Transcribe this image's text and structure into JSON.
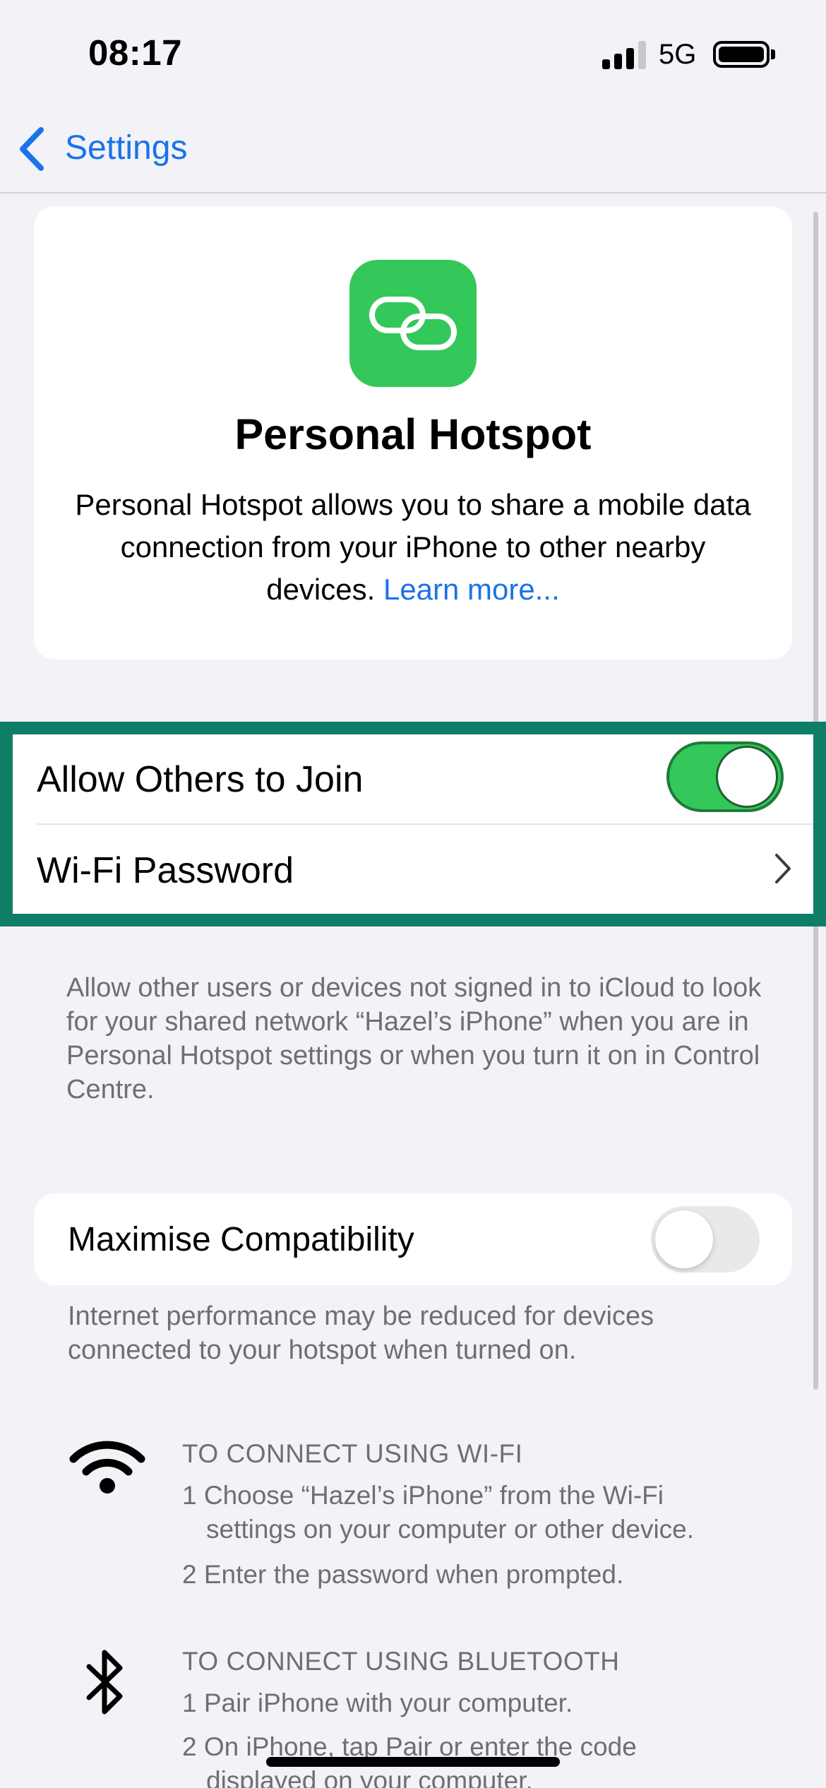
{
  "status_bar": {
    "time": "08:17",
    "network": "5G",
    "signal_bars_active": 3,
    "signal_bars_total": 4,
    "battery_level": 1.0
  },
  "nav": {
    "back_label": "Settings",
    "back_icon": "chevron-left-icon"
  },
  "header": {
    "icon": "link-icon",
    "title": "Personal Hotspot",
    "description": "Personal Hotspot allows you to share a mobile data connection from your iPhone to other nearby devices.",
    "learn_more": "Learn more..."
  },
  "settings": {
    "allow_others_label": "Allow Others to Join",
    "allow_others_on": true,
    "wifi_password_label": "Wi-Fi Password",
    "allow_others_footnote": "Allow other users or devices not signed in to iCloud to look for your shared network “Hazel’s iPhone” when you are in Personal Hotspot settings or when you turn it on in Control Centre.",
    "maximise_label": "Maximise Compatibility",
    "maximise_on": false,
    "maximise_footnote": "Internet performance may be reduced for devices connected to your hotspot when turned on."
  },
  "instructions": {
    "wifi": {
      "icon": "wifi-icon",
      "heading": "TO CONNECT USING WI-FI",
      "step1": "1 Choose “Hazel’s iPhone” from the Wi-Fi",
      "step1_cont": "settings on your computer or other device.",
      "step2": "2 Enter the password when prompted."
    },
    "bluetooth": {
      "icon": "bluetooth-icon",
      "heading": "TO CONNECT USING BLUETOOTH",
      "step1": "1 Pair iPhone with your computer.",
      "step2": "2 On iPhone, tap Pair or enter the code",
      "step2_cont": "displayed on your computer."
    }
  },
  "colors": {
    "accent": "#1a73e8",
    "toggle_on": "#34c759",
    "highlight": "#0e7f66",
    "background": "#f2f2f7"
  }
}
